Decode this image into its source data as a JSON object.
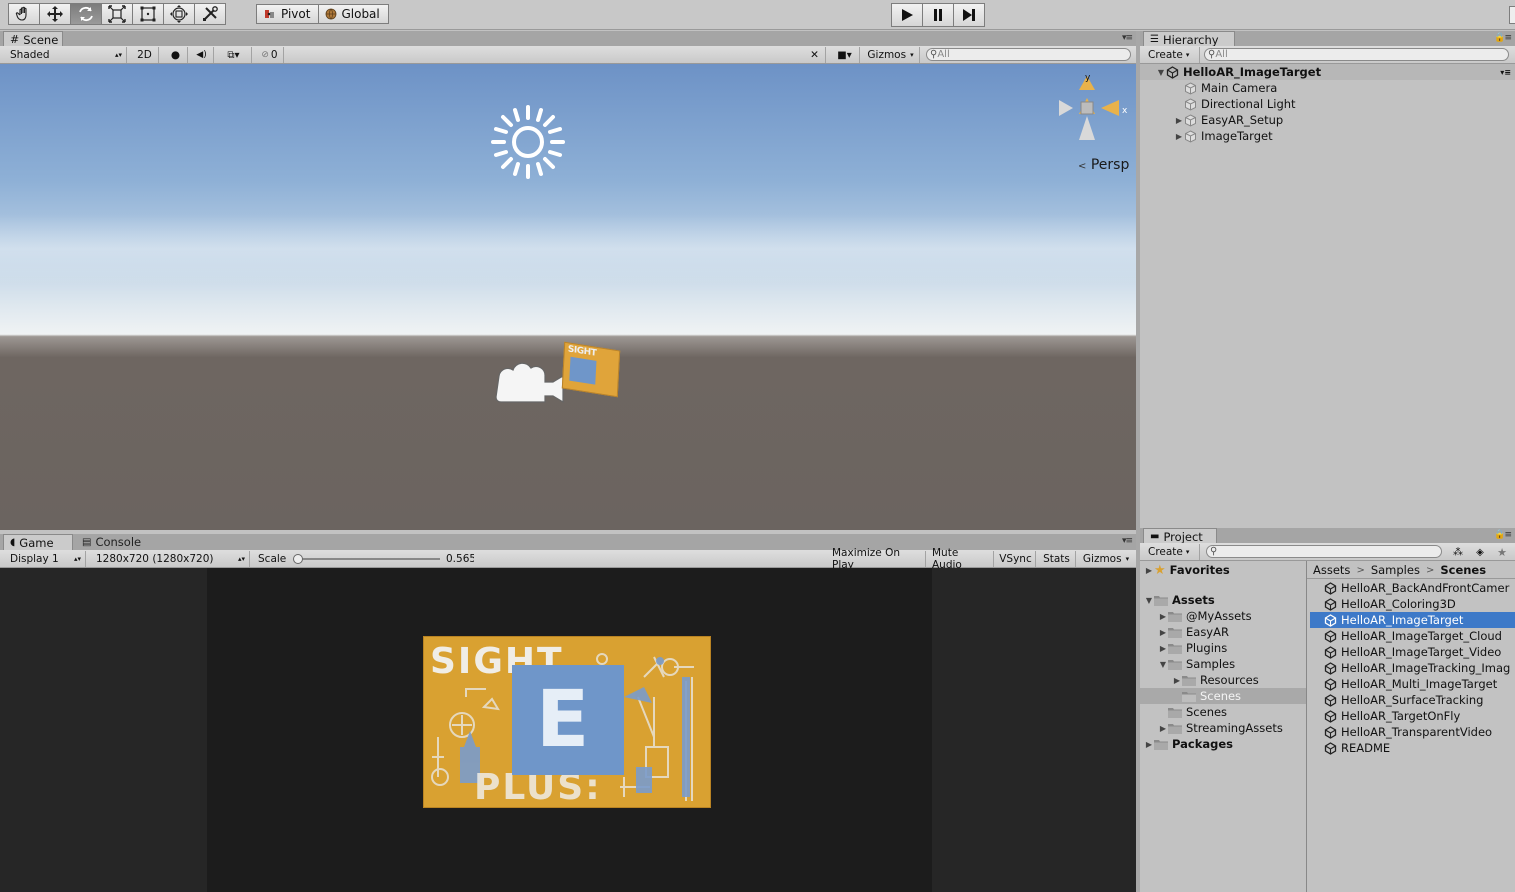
{
  "toolbar": {
    "pivot": "Pivot",
    "global": "Global"
  },
  "scene": {
    "tab": "Scene",
    "shading": "Shaded",
    "mode_2d": "2D",
    "hidden_count": "0",
    "gizmos": "Gizmos",
    "search_placeholder": "All",
    "projection": "Persp",
    "axis_y": "y",
    "axis_x": "x"
  },
  "game": {
    "tab": "Game",
    "console_tab": "Console",
    "display": "Display 1",
    "resolution": "1280x720 (1280x720)",
    "scale_label": "Scale",
    "scale_value": "0.565",
    "scale_fraction": 0.02,
    "maximize": "Maximize On Play",
    "mute": "Mute Audio",
    "vsync": "VSync",
    "stats": "Stats",
    "gizmos": "Gizmos",
    "target_text_top": "SIGHT",
    "target_text_bottom": "PLUS:",
    "target_letter": "E",
    "mini_target_text": "SIGHT"
  },
  "hierarchy": {
    "tab": "Hierarchy",
    "create": "Create",
    "search_placeholder": "All",
    "scene_name": "HelloAR_ImageTarget",
    "items": [
      {
        "label": "Main Camera",
        "expandable": false
      },
      {
        "label": "Directional Light",
        "expandable": false
      },
      {
        "label": "EasyAR_Setup",
        "expandable": true
      },
      {
        "label": "ImageTarget",
        "expandable": true
      }
    ]
  },
  "project": {
    "tab": "Project",
    "create": "Create",
    "favorites": "Favorites",
    "assets": "Assets",
    "packages": "Packages",
    "tree": [
      "@MyAssets",
      "EasyAR",
      "Plugins",
      "Samples",
      "Resources",
      "Scenes",
      "Scenes",
      "StreamingAssets"
    ],
    "breadcrumb": [
      "Assets",
      "Samples",
      "Scenes"
    ],
    "files": [
      "HelloAR_BackAndFrontCamer",
      "HelloAR_Coloring3D",
      "HelloAR_ImageTarget",
      "HelloAR_ImageTarget_Cloud",
      "HelloAR_ImageTarget_Video",
      "HelloAR_ImageTracking_Imag",
      "HelloAR_Multi_ImageTarget",
      "HelloAR_SurfaceTracking",
      "HelloAR_TargetOnFly",
      "HelloAR_TransparentVideo",
      "README"
    ],
    "selected_file": "HelloAR_ImageTarget"
  },
  "colors": {
    "selection": "#3d79c8",
    "panel": "#c2c2c2",
    "target_gold": "#d9a131",
    "target_blue": "#6f96c9"
  }
}
